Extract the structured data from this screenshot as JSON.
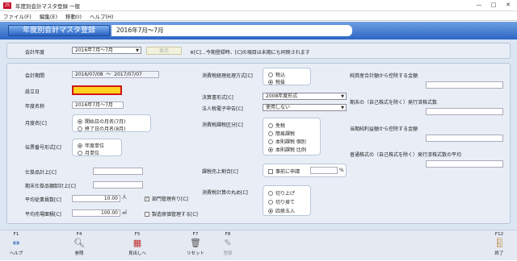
{
  "window": {
    "app_icon": "25",
    "title": "年度別会計マスタ登録 一般"
  },
  "menu": [
    "ファイル(F)",
    "編集(E)",
    "移動(I)",
    "ヘルプ(H)"
  ],
  "header": {
    "badge": "年度別会計マスタ登録",
    "period": "2016年7月〜7月"
  },
  "top": {
    "year_label": "会計年度",
    "year_value": "2016年7月〜7月",
    "show_button": "表示",
    "note": "※[C]…今期登録時、[C]の項目は未期にも同映されます"
  },
  "left": {
    "period_label": "会計期間",
    "period_from": "2016/07/08",
    "period_sep": "〜",
    "period_to": "2017/07/07",
    "established_label": "設立日",
    "established_value": "",
    "year_name_label": "年度名称",
    "year_name_value": "2016年7月〜7月",
    "month_name_label": "月度名[C]",
    "month_opt1": "開始日の月名(7月)",
    "month_opt2": "終了日の月名(8月)",
    "slip_label": "伝票番号形式[C]",
    "slip_opt1": "年度単位",
    "slip_opt2": "月単位",
    "wip_label": "仕掛品計上[C]",
    "wip_begin_label": "期末仕掛品棚卸計上[C]",
    "employees_label": "平均従業員数[C]",
    "employees_value": "10.00",
    "employees_unit": "人",
    "area_label": "平均売場面積[C]",
    "area_value": "100.00",
    "area_unit": "㎡",
    "dept_check": "部門管理有り[C]",
    "cost_check": "製造原価管理する[C]"
  },
  "middle": {
    "tax_method_label": "消費税経理処理方式[C]",
    "tax_opt1": "税込",
    "tax_opt2": "税抜",
    "settle_label": "決算書形式[C]",
    "settle_value": "2008年度形式",
    "corp_label": "法人税電子申告[C]",
    "corp_value": "使用しない",
    "tax_class_label": "消費税課税区分[C]",
    "class_opt1": "免税",
    "class_opt2": "簡易課税",
    "class_opt3": "本則課税 個別",
    "class_opt4": "本則課税 比例",
    "ratio_label": "課税売上割合[C]",
    "ratio_check": "事前に申請",
    "ratio_unit": "%",
    "round_label": "消費税計算の丸め[C]",
    "round_opt1": "切り上げ",
    "round_opt2": "切り捨て",
    "round_opt3": "四捨五入"
  },
  "right": {
    "r1": "純資産合計額から控除する金額",
    "r2": "期末の（自己株式を除く）発行済株式数",
    "r3": "当期純利益額から控除する金額",
    "r4": "普通株式の（自己株式を除く）発行済株式数の平均"
  },
  "fkeys": [
    {
      "key": "F1",
      "label": "ヘルプ"
    },
    {
      "key": "F4",
      "label": "参照"
    },
    {
      "key": "F5",
      "label": "見出しへ"
    },
    {
      "key": "F7",
      "label": "リセット"
    },
    {
      "key": "F8",
      "label": "登録"
    },
    {
      "key": "F12",
      "label": "終了"
    }
  ],
  "colors": {
    "header_blue": "#2d66c4",
    "panel_bg": "#dce6f3",
    "highlight": "#ffd21f"
  }
}
